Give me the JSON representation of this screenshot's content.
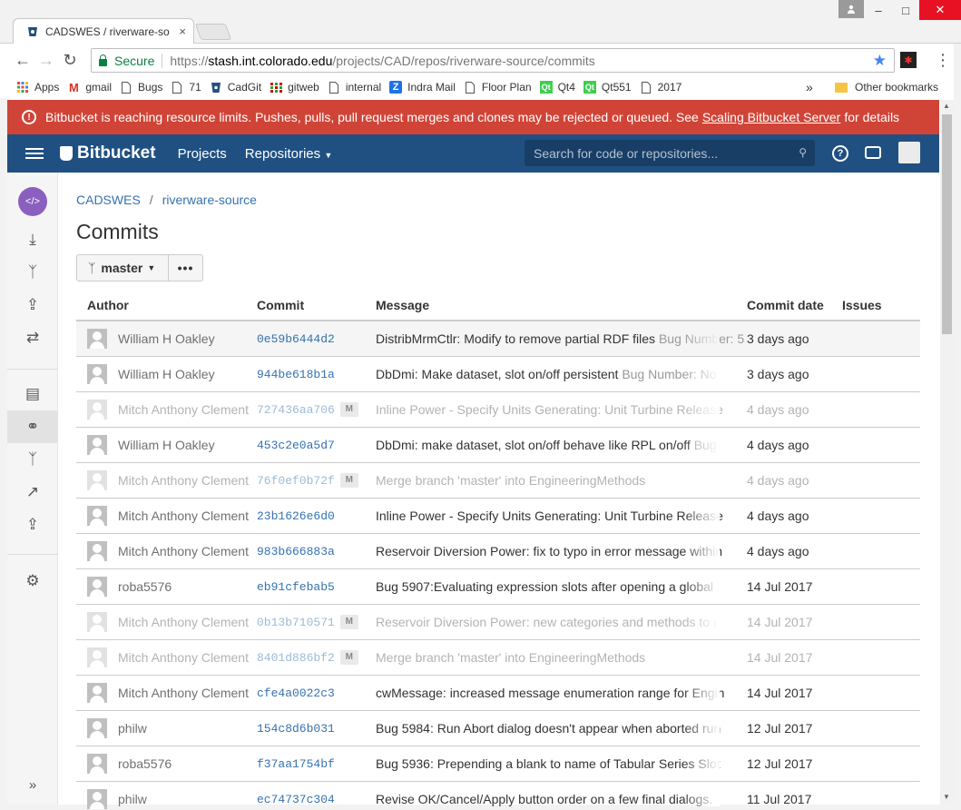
{
  "browser": {
    "tab_title": "CADSWES / riverware-so",
    "tab_close": "×",
    "secure_label": "Secure",
    "url_scheme": "https://",
    "url_host": "stash.int.colorado.edu",
    "url_path": "/projects/CAD/repos/riverware-source/commits",
    "bookmarks": [
      {
        "label": "Apps",
        "icon": "apps-grid-icon"
      },
      {
        "label": "gmail",
        "icon": "gmail-icon"
      },
      {
        "label": "Bugs",
        "icon": "page-icon"
      },
      {
        "label": "71",
        "icon": "page-icon"
      },
      {
        "label": "CadGit",
        "icon": "bitbucket-icon"
      },
      {
        "label": "gitweb",
        "icon": "gitweb-icon"
      },
      {
        "label": "internal",
        "icon": "page-icon"
      },
      {
        "label": "Indra Mail",
        "icon": "zimbra-icon"
      },
      {
        "label": "Floor Plan",
        "icon": "page-icon"
      },
      {
        "label": "Qt4",
        "icon": "qt-icon"
      },
      {
        "label": "Qt551",
        "icon": "qt-icon"
      },
      {
        "label": "2017",
        "icon": "page-icon"
      }
    ],
    "bookmarks_more": "»",
    "other_bookmarks": "Other bookmarks"
  },
  "banner": {
    "text_before": "Bitbucket is reaching resource limits. Pushes, pulls, pull request merges and clones may be rejected or queued. See",
    "link": "Scaling Bitbucket Server",
    "text_after": "for details",
    "color": "#d04437"
  },
  "header": {
    "logo": "Bitbucket",
    "nav_projects": "Projects",
    "nav_repositories": "Repositories",
    "search_placeholder": "Search for code or repositories...",
    "color": "#205081"
  },
  "breadcrumb": {
    "project": "CADSWES",
    "repo": "riverware-source"
  },
  "page_title": "Commits",
  "branch": "master",
  "more_label": "•••",
  "columns": [
    "Author",
    "Commit",
    "Message",
    "Commit date",
    "Issues"
  ],
  "commits": [
    {
      "author": "William H Oakley",
      "hash": "0e59b6444d2",
      "merge": false,
      "message": "DistribMrmCtlr: Modify to remove partial RDF files",
      "bug": "Bug Number: 5",
      "date": "3 days ago"
    },
    {
      "author": "William H Oakley",
      "hash": "944be618b1a",
      "merge": false,
      "message": "DbDmi: Make dataset, slot on/off persistent",
      "bug": "Bug Number: No",
      "date": "3 days ago"
    },
    {
      "author": "Mitch Anthony Clement",
      "hash": "727436aa706",
      "merge": true,
      "message": "Inline Power - Specify Units Generating: Unit Turbine Release",
      "bug": "",
      "date": "4 days ago"
    },
    {
      "author": "William H Oakley",
      "hash": "453c2e0a5d7",
      "merge": false,
      "message": "DbDmi: make dataset, slot on/off behave like RPL on/off",
      "bug": "Bug",
      "date": "4 days ago"
    },
    {
      "author": "Mitch Anthony Clement",
      "hash": "76f0ef0b72f",
      "merge": true,
      "message": "Merge branch 'master' into EngineeringMethods",
      "bug": "",
      "date": "4 days ago"
    },
    {
      "author": "Mitch Anthony Clement",
      "hash": "23b1626e6d0",
      "merge": false,
      "message": "Inline Power - Specify Units Generating: Unit Turbine Release",
      "bug": "",
      "date": "4 days ago"
    },
    {
      "author": "Mitch Anthony Clement",
      "hash": "983b666883a",
      "merge": false,
      "message": "Reservoir Diversion Power: fix to typo in error message within",
      "bug": "",
      "date": "4 days ago"
    },
    {
      "author": "roba5576",
      "hash": "eb91cfebab5",
      "merge": false,
      "message": "Bug 5907:Evaluating expression slots after opening a global",
      "bug": "",
      "date": "14 Jul 2017"
    },
    {
      "author": "Mitch Anthony Clement",
      "hash": "0b13b710571",
      "merge": true,
      "message": "Reservoir Diversion Power: new categories and methods to r",
      "bug": "",
      "date": "14 Jul 2017"
    },
    {
      "author": "Mitch Anthony Clement",
      "hash": "8401d886bf2",
      "merge": true,
      "message": "Merge branch 'master' into EngineeringMethods",
      "bug": "",
      "date": "14 Jul 2017"
    },
    {
      "author": "Mitch Anthony Clement",
      "hash": "cfe4a0022c3",
      "merge": false,
      "message": "cwMessage: increased message enumeration range for Engin",
      "bug": "",
      "date": "14 Jul 2017"
    },
    {
      "author": "philw",
      "hash": "154c8d6b031",
      "merge": false,
      "message": "Bug 5984: Run Abort dialog doesn't appear when aborted run",
      "bug": "",
      "date": "12 Jul 2017"
    },
    {
      "author": "roba5576",
      "hash": "f37aa1754bf",
      "merge": false,
      "message": "Bug 5936: Prepending a blank to name of Tabular Series Slot",
      "bug": "",
      "date": "12 Jul 2017"
    },
    {
      "author": "philw",
      "hash": "ec74737c304",
      "merge": false,
      "message": "Revise OK/Cancel/Apply button order on a few final dialogs.",
      "bug": "",
      "date": "11 Jul 2017"
    }
  ],
  "merge_badge": "M",
  "sidebar_expand": "»"
}
